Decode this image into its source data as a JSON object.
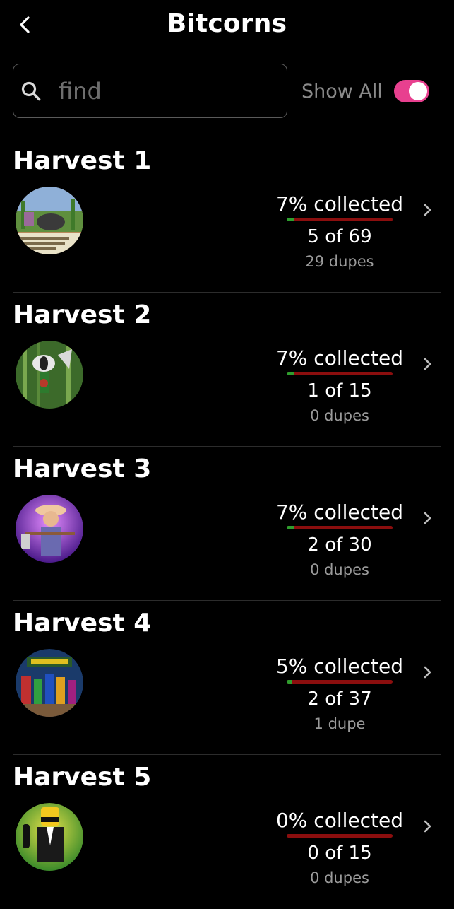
{
  "header": {
    "title": "Bitcorns",
    "back_icon": "chevron-left-icon"
  },
  "search": {
    "placeholder": "find",
    "value": "",
    "icon": "search-icon"
  },
  "show_all": {
    "label": "Show All",
    "enabled": true
  },
  "colors": {
    "background": "#000000",
    "text": "#ffffff",
    "muted_text": "#9a9a9a",
    "toggle_on": "#e8408f",
    "progress_track": "#8b0e0e",
    "progress_fill": "#2e9e2e",
    "divider": "#2c2c2c"
  },
  "harvests": [
    {
      "title": "Harvest 1",
      "collected_label": "7% collected",
      "collected_fraction": 0.07,
      "count_label": "5 of 69",
      "dupes_label": "29 dupes"
    },
    {
      "title": "Harvest 2",
      "collected_label": "7% collected",
      "collected_fraction": 0.07,
      "count_label": "1 of 15",
      "dupes_label": "0 dupes"
    },
    {
      "title": "Harvest 3",
      "collected_label": "7% collected",
      "collected_fraction": 0.07,
      "count_label": "2 of 30",
      "dupes_label": "0 dupes"
    },
    {
      "title": "Harvest 4",
      "collected_label": "5% collected",
      "collected_fraction": 0.05,
      "count_label": "2 of 37",
      "dupes_label": "1 dupe"
    },
    {
      "title": "Harvest 5",
      "collected_label": "0% collected",
      "collected_fraction": 0.0,
      "count_label": "0 of 15",
      "dupes_label": "0 dupes"
    }
  ]
}
